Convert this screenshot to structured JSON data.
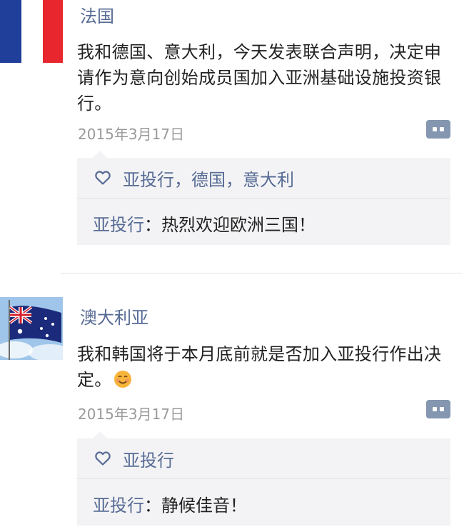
{
  "posts": [
    {
      "author": "法国",
      "avatar": "france-flag",
      "text": "我和德国、意大利，今天发表联合声明，决定申请作为意向创始成员国加入亚洲基础设施投资银行。",
      "time": "2015年3月17日",
      "likes": "亚投行，德国，意大利",
      "reply": {
        "author": "亚投行",
        "separator": "：",
        "text": "热烈欢迎欧洲三国！"
      }
    },
    {
      "author": "澳大利亚",
      "avatar": "australia-flag",
      "text": "我和韩国将于本月底前就是否加入亚投行作出决定。",
      "emoji": "smile-emoji",
      "time": "2015年3月17日",
      "likes": "亚投行",
      "reply": {
        "author": "亚投行",
        "separator": "：",
        "text": "静候佳音！"
      }
    }
  ],
  "colors": {
    "link": "#576b95",
    "time": "#9a9a9a",
    "panel": "#f3f3f5"
  }
}
